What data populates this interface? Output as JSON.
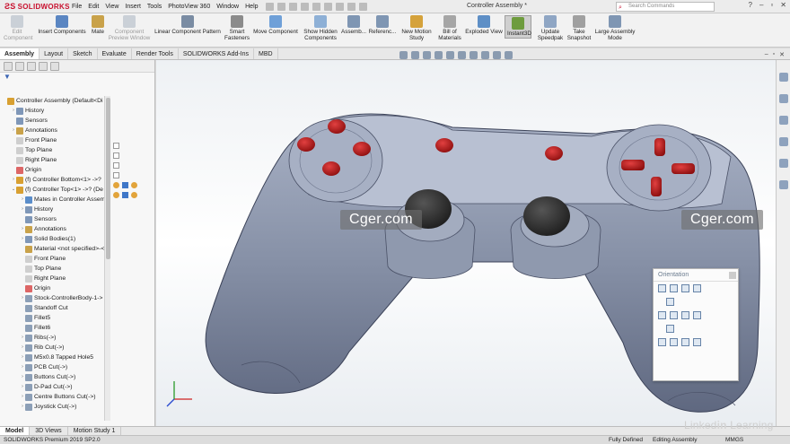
{
  "app": {
    "brand": "SOLIDWORKS",
    "doc_title": "Controller Assembly *"
  },
  "menu": [
    "File",
    "Edit",
    "View",
    "Insert",
    "Tools",
    "PhotoView 360",
    "Window",
    "Help"
  ],
  "search": {
    "placeholder": "Search Commands"
  },
  "ribbon": [
    {
      "label": "Edit Component",
      "disabled": true,
      "color": "#9aa6b5"
    },
    {
      "label": "Insert Components",
      "disabled": false,
      "color": "#5b86c2"
    },
    {
      "label": "Mate",
      "disabled": false,
      "color": "#c9a24a"
    },
    {
      "label": "Component Preview Window",
      "disabled": true,
      "color": "#9aa6b5"
    },
    {
      "label": "Linear Component Pattern",
      "disabled": false,
      "color": "#7a8ca3"
    },
    {
      "label": "Smart Fasteners",
      "disabled": false,
      "color": "#8b8b8b"
    },
    {
      "label": "Move Component",
      "disabled": false,
      "color": "#6fa0d8"
    },
    {
      "label": "Show Hidden Components",
      "disabled": false,
      "color": "#8eb0d6"
    },
    {
      "label": "Assemb...",
      "disabled": false,
      "color": "#7f96b3"
    },
    {
      "label": "Referenc...",
      "disabled": false,
      "color": "#7f96b3"
    },
    {
      "label": "New Motion Study",
      "disabled": false,
      "color": "#d5a23b"
    },
    {
      "label": "Bill of Materials",
      "disabled": false,
      "color": "#a6a6a6"
    },
    {
      "label": "Exploded View",
      "disabled": false,
      "color": "#5e8fc6"
    },
    {
      "label": "Instant3D",
      "disabled": false,
      "color": "#6e9c3e"
    },
    {
      "label": "Update Speedpak",
      "disabled": false,
      "color": "#8fa6c4"
    },
    {
      "label": "Take Snapshot",
      "disabled": false,
      "color": "#a0a0a0"
    },
    {
      "label": "Large Assembly Mode",
      "disabled": false,
      "color": "#7f96b3"
    }
  ],
  "command_tabs": [
    "Assembly",
    "Layout",
    "Sketch",
    "Evaluate",
    "Render Tools",
    "SOLIDWORKS Add-Ins",
    "MBD"
  ],
  "tree": [
    {
      "label": "Controller Assembly  (Default<Di",
      "indent": 0,
      "arrow": "",
      "color": "#d8a032"
    },
    {
      "label": "History",
      "indent": 1,
      "arrow": "›",
      "color": "#7f97b8"
    },
    {
      "label": "Sensors",
      "indent": 1,
      "arrow": "",
      "color": "#7f97b8"
    },
    {
      "label": "Annotations",
      "indent": 1,
      "arrow": "›",
      "color": "#c9a24a"
    },
    {
      "label": "Front Plane",
      "indent": 1,
      "arrow": "",
      "color": "#cfcfcf"
    },
    {
      "label": "Top Plane",
      "indent": 1,
      "arrow": "",
      "color": "#cfcfcf"
    },
    {
      "label": "Right Plane",
      "indent": 1,
      "arrow": "",
      "color": "#cfcfcf"
    },
    {
      "label": "Origin",
      "indent": 1,
      "arrow": "",
      "color": "#d66"
    },
    {
      "label": "(f) Controller Bottom<1> ->?",
      "indent": 1,
      "arrow": "›",
      "color": "#d8a032"
    },
    {
      "label": "(f) Controller Top<1> ->? (De",
      "indent": 1,
      "arrow": "⌄",
      "color": "#d8a032"
    },
    {
      "label": "Mates in Controller Assem",
      "indent": 2,
      "arrow": "›",
      "color": "#5a8dca"
    },
    {
      "label": "History",
      "indent": 2,
      "arrow": "›",
      "color": "#7f97b8"
    },
    {
      "label": "Sensors",
      "indent": 2,
      "arrow": "",
      "color": "#7f97b8"
    },
    {
      "label": "Annotations",
      "indent": 2,
      "arrow": "›",
      "color": "#c9a24a"
    },
    {
      "label": "Solid Bodies(1)",
      "indent": 2,
      "arrow": "›",
      "color": "#7f97b8"
    },
    {
      "label": "Material <not specified>-<",
      "indent": 2,
      "arrow": "",
      "color": "#c9a24a"
    },
    {
      "label": "Front Plane",
      "indent": 2,
      "arrow": "",
      "color": "#cfcfcf"
    },
    {
      "label": "Top Plane",
      "indent": 2,
      "arrow": "",
      "color": "#cfcfcf"
    },
    {
      "label": "Right Plane",
      "indent": 2,
      "arrow": "",
      "color": "#cfcfcf"
    },
    {
      "label": "Origin",
      "indent": 2,
      "arrow": "",
      "color": "#d66"
    },
    {
      "label": "Stock-ControllerBody-1->",
      "indent": 2,
      "arrow": "›",
      "color": "#8c9fb7"
    },
    {
      "label": "Standoff Cut",
      "indent": 2,
      "arrow": "",
      "color": "#8c9fb7"
    },
    {
      "label": "Fillet5",
      "indent": 2,
      "arrow": "",
      "color": "#8c9fb7"
    },
    {
      "label": "Fillet6",
      "indent": 2,
      "arrow": "",
      "color": "#8c9fb7"
    },
    {
      "label": "Ribs(->)",
      "indent": 2,
      "arrow": "›",
      "color": "#8c9fb7"
    },
    {
      "label": "Rib Cut(->)",
      "indent": 2,
      "arrow": "›",
      "color": "#8c9fb7"
    },
    {
      "label": "M5x0.8 Tapped Hole5",
      "indent": 2,
      "arrow": "›",
      "color": "#8c9fb7"
    },
    {
      "label": "PCB Cut(->)",
      "indent": 2,
      "arrow": "›",
      "color": "#8c9fb7"
    },
    {
      "label": "Buttons Cut(->)",
      "indent": 2,
      "arrow": "›",
      "color": "#8c9fb7"
    },
    {
      "label": "D-Pad Cut(->)",
      "indent": 2,
      "arrow": "›",
      "color": "#8c9fb7"
    },
    {
      "label": "Centre Buttons Cut(->)",
      "indent": 2,
      "arrow": "›",
      "color": "#8c9fb7"
    },
    {
      "label": "Joystick Cut(->)",
      "indent": 2,
      "arrow": "›",
      "color": "#8c9fb7"
    }
  ],
  "watermark": "Cger.com",
  "orientation": {
    "title": "Orientation"
  },
  "bottom_tabs": [
    "Model",
    "3D Views",
    "Motion Study 1"
  ],
  "status": {
    "version": "SOLIDWORKS Premium 2019 SP2.0",
    "defined": "Fully Defined",
    "mode": "Editing Assembly",
    "units": "MMGS"
  },
  "branding": {
    "linked": "Linked",
    "in": "in",
    "learning": "Learning"
  },
  "colors": {
    "body": "#7b8499",
    "button": "#c01818",
    "thumbstick": "#2d2d2d",
    "accent": "#c8102e"
  }
}
